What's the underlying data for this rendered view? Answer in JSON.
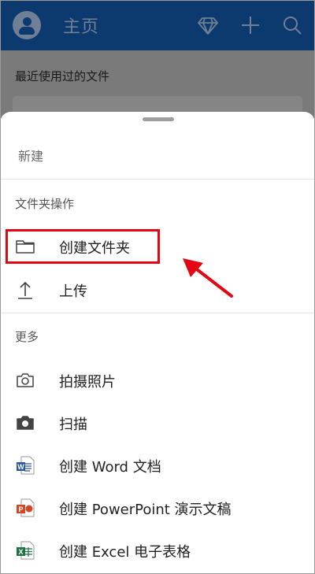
{
  "header": {
    "title": "主页",
    "accent": "#0d3a6e"
  },
  "background": {
    "recent_label": "最近使用过的文件"
  },
  "sheet": {
    "new_label": "新建",
    "folder_section_label": "文件夹操作",
    "folder_items": [
      {
        "label": "创建文件夹",
        "icon": "folder-icon"
      },
      {
        "label": "上传",
        "icon": "upload-icon"
      }
    ],
    "more_section_label": "更多",
    "more_items": [
      {
        "label": "拍摄照片",
        "icon": "camera-outline-icon"
      },
      {
        "label": "扫描",
        "icon": "camera-filled-icon"
      },
      {
        "label": "创建 Word 文档",
        "icon": "word-icon"
      },
      {
        "label": "创建 PowerPoint 演示文稿",
        "icon": "powerpoint-icon"
      },
      {
        "label": "创建 Excel 电子表格",
        "icon": "excel-icon"
      }
    ]
  },
  "colors": {
    "highlight": "#e30613",
    "word": "#2b579a",
    "powerpoint": "#d24726",
    "excel": "#217346"
  }
}
